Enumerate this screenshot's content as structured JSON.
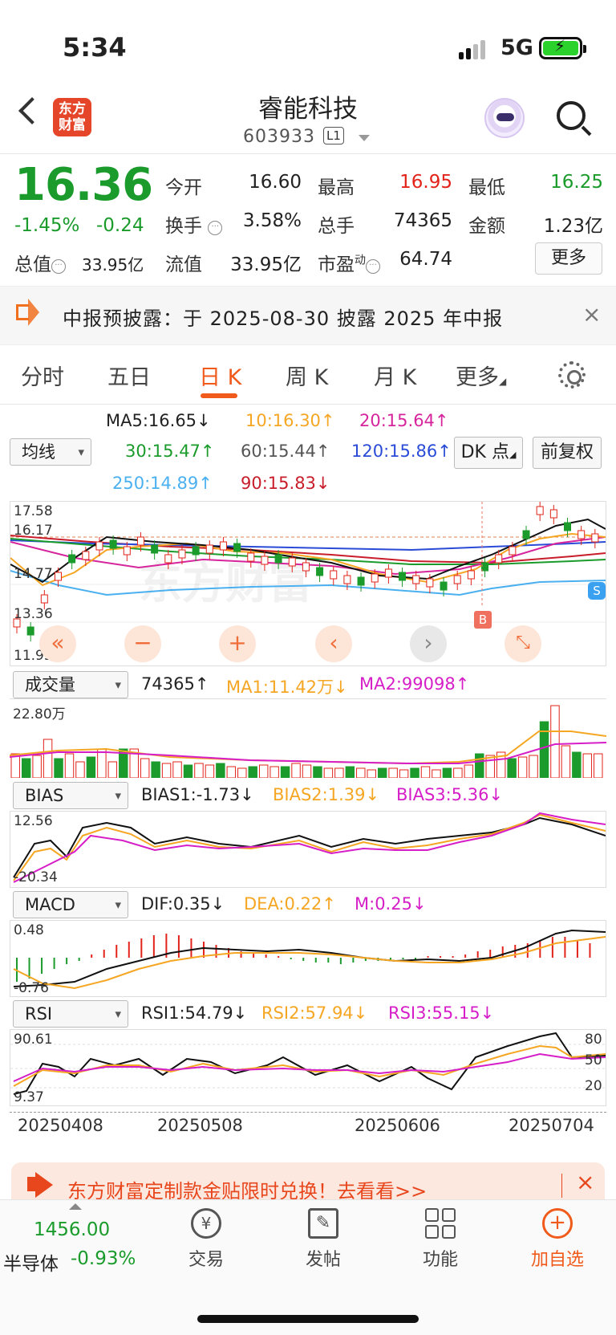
{
  "status_bar": {
    "time": "5:34",
    "network": "5G"
  },
  "header": {
    "logo_text": "东方财富",
    "stock_name": "睿能科技",
    "stock_code": "603933",
    "level": "L1"
  },
  "quote": {
    "price": "16.36",
    "change_pct": "-1.45%",
    "change": "-0.24",
    "open_label": "今开",
    "open": "16.60",
    "high_label": "最高",
    "high": "16.95",
    "low_label": "最低",
    "low": "16.25",
    "turnover_label": "换手",
    "turnover": "3.58%",
    "volume_label": "总手",
    "volume": "74365",
    "amount_label": "金额",
    "amount": "1.23亿",
    "mktcap_label": "总值",
    "mktcap": "33.95亿",
    "float_label": "流值",
    "float": "33.95亿",
    "pe_label": "市盈",
    "pe_sup": "动",
    "pe": "64.74",
    "more_label": "更多"
  },
  "notice": {
    "text": "中报预披露：于 2025-08-30 披露 2025 年中报"
  },
  "tabs": [
    "分时",
    "五日",
    "日 K",
    "周 K",
    "月 K",
    "更多"
  ],
  "active_tab": "日 K",
  "ma_panel": {
    "selector": "均线",
    "ma5": "MA5:16.65",
    "ma10": "10:16.30",
    "ma20": "20:15.64",
    "ma30": "30:15.47",
    "ma60": "60:15.44",
    "ma120": "120:15.86",
    "ma250": "250:14.89",
    "ma90": "90:15.83",
    "dk_button": "DK 点",
    "adjust_button": "前复权"
  },
  "kline_axis": {
    "top": "17.58",
    "ref": "16.17",
    "mid": "14.77",
    "low": "13.36",
    "bottom": "11.95"
  },
  "kline_markers": {
    "buy": "B",
    "sell": "S"
  },
  "volume_panel": {
    "selector": "成交量",
    "value": "74365",
    "ma1": "MA1:11.42万",
    "ma2": "MA2:99098",
    "axis_top": "22.80万"
  },
  "bias_panel": {
    "selector": "BIAS",
    "bias1": "BIAS1:-1.73",
    "bias2": "BIAS2:1.39",
    "bias3": "BIAS3:5.36",
    "axis_top": "12.56",
    "axis_bottom": "-20.34"
  },
  "macd_panel": {
    "selector": "MACD",
    "dif": "DIF:0.35",
    "dea": "DEA:0.22",
    "m": "M:0.25",
    "axis_top": "0.48",
    "axis_bottom": "-0.76"
  },
  "rsi_panel": {
    "selector": "RSI",
    "rsi1": "RSI1:54.79",
    "rsi2": "RSI2:57.94",
    "rsi3": "RSI3:55.15",
    "axis_top": "90.61",
    "axis_bottom": "9.37",
    "r80": "80",
    "r50": "50",
    "r20": "20"
  },
  "dates": [
    "20250408",
    "20250508",
    "20250606",
    "20250704"
  ],
  "ad": {
    "text": "东方财富定制款金贴限时兑换！去看看>>"
  },
  "bottom_bar": {
    "index_value": "1456.00",
    "index_name": "半导体",
    "index_change": "-0.93%",
    "trade": "交易",
    "post": "发帖",
    "function": "功能",
    "add_watch": "加自选"
  },
  "colors": {
    "up": "#e2231a",
    "down": "#1a9b2b",
    "accent": "#f05a1a"
  }
}
